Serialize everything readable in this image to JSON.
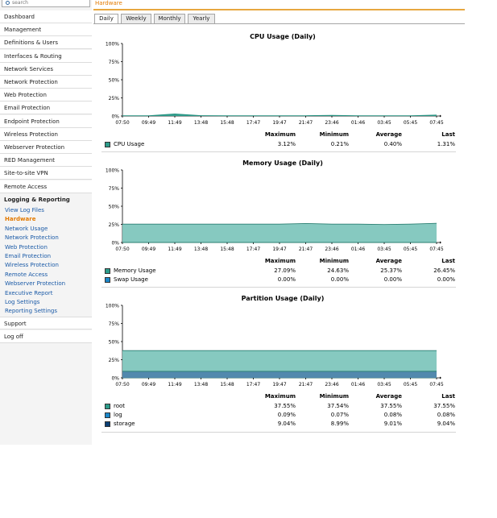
{
  "sidebar": {
    "search_placeholder": "search",
    "items": [
      "Dashboard",
      "Management",
      "Definitions & Users",
      "Interfaces & Routing",
      "Network Services",
      "Network Protection",
      "Web Protection",
      "Email Protection",
      "Endpoint Protection",
      "Wireless Protection",
      "Webserver Protection",
      "RED Management",
      "Site-to-site VPN",
      "Remote Access"
    ],
    "logging_label": "Logging & Reporting",
    "sub_items": [
      "View Log Files",
      "Hardware",
      "Network Usage",
      "Network Protection",
      "Web Protection",
      "Email Protection",
      "Wireless Protection",
      "Remote Access",
      "Webserver Protection",
      "Executive Report",
      "Log Settings",
      "Reporting Settings"
    ],
    "active_sub": "Hardware",
    "bottom_items": [
      "Support",
      "Log off"
    ]
  },
  "header": {
    "title": "Hardware",
    "accent": "#e37a00"
  },
  "tabs": [
    "Daily",
    "Weekly",
    "Monthly",
    "Yearly"
  ],
  "active_tab": "Daily",
  "colors": {
    "teal": "#7fc6bd",
    "teal_line": "#2b9c8a",
    "blue": "#1b87c9",
    "navy": "#0c3f75",
    "storage_fill": "#4f86ac"
  },
  "stats_headers": {
    "max": "Maximum",
    "min": "Minimum",
    "avg": "Average",
    "last": "Last"
  },
  "x_labels": [
    "07:50",
    "09:49",
    "11:49",
    "13:48",
    "15:48",
    "17:47",
    "19:47",
    "21:47",
    "23:46",
    "01:46",
    "03:45",
    "05:45",
    "07:45"
  ],
  "y_labels": [
    "100%",
    "75%",
    "50%",
    "25%",
    "0%"
  ],
  "chart_data": [
    {
      "type": "area",
      "title": "CPU Usage (Daily)",
      "ylim": [
        0,
        100
      ],
      "series": [
        {
          "name": "CPU Usage",
          "color": "#2b9c8a",
          "values": [
            0.4,
            0.4,
            2.8,
            0.5,
            0.4,
            0.3,
            0.4,
            0.4,
            0.9,
            0.4,
            0.4,
            0.4,
            1.3
          ]
        }
      ],
      "stats": [
        {
          "name": "CPU Usage",
          "color": "#2b9c8a",
          "max": "3.12%",
          "min": "0.21%",
          "avg": "0.40%",
          "last": "1.31%"
        }
      ]
    },
    {
      "type": "area",
      "title": "Memory Usage (Daily)",
      "ylim": [
        0,
        100
      ],
      "series": [
        {
          "name": "Memory Usage",
          "color": "#7fc6bd",
          "values": [
            25.3,
            25.3,
            25.3,
            25.3,
            25.3,
            25.3,
            25.4,
            26.2,
            25.4,
            25.3,
            24.8,
            25.3,
            26.5
          ]
        },
        {
          "name": "Swap Usage",
          "color": "#1b87c9",
          "values": [
            0,
            0,
            0,
            0,
            0,
            0,
            0,
            0,
            0,
            0,
            0,
            0,
            0
          ]
        }
      ],
      "stats": [
        {
          "name": "Memory Usage",
          "color": "#2b9c8a",
          "max": "27.09%",
          "min": "24.63%",
          "avg": "25.37%",
          "last": "26.45%"
        },
        {
          "name": "Swap Usage",
          "color": "#1b87c9",
          "max": "0.00%",
          "min": "0.00%",
          "avg": "0.00%",
          "last": "0.00%"
        }
      ]
    },
    {
      "type": "area",
      "title": "Partition Usage (Daily)",
      "ylim": [
        0,
        100
      ],
      "series": [
        {
          "name": "root",
          "color": "#7fc6bd",
          "values": [
            37.55,
            37.55,
            37.55,
            37.55,
            37.55,
            37.55,
            37.55,
            37.55,
            37.55,
            37.55,
            37.55,
            37.55,
            37.55
          ]
        },
        {
          "name": "log",
          "color": "#1b87c9",
          "values": [
            0.08,
            0.08,
            0.08,
            0.08,
            0.08,
            0.08,
            0.08,
            0.08,
            0.08,
            0.08,
            0.08,
            0.08,
            0.08
          ]
        },
        {
          "name": "storage",
          "color": "#4f86ac",
          "values": [
            9.0,
            9.0,
            9.0,
            9.0,
            9.0,
            9.0,
            9.0,
            9.0,
            9.0,
            9.0,
            9.0,
            9.0,
            9.04
          ]
        }
      ],
      "stats": [
        {
          "name": "root",
          "color": "#2b9c8a",
          "max": "37.55%",
          "min": "37.54%",
          "avg": "37.55%",
          "last": "37.55%"
        },
        {
          "name": "log",
          "color": "#1b87c9",
          "max": "0.09%",
          "min": "0.07%",
          "avg": "0.08%",
          "last": "0.08%"
        },
        {
          "name": "storage",
          "color": "#0c3f75",
          "max": "9.04%",
          "min": "8.99%",
          "avg": "9.01%",
          "last": "9.04%"
        }
      ]
    }
  ]
}
